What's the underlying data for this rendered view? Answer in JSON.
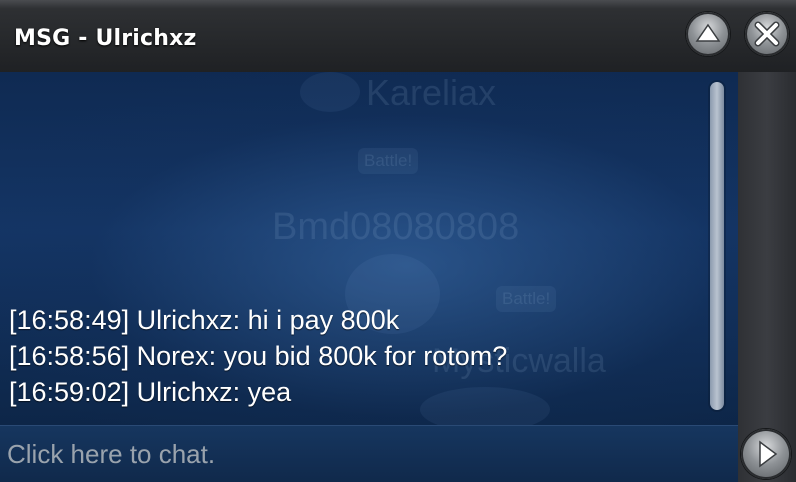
{
  "window": {
    "title": "MSG - Ulrichxz",
    "buttons": {
      "collapse_icon": "triangle-up-icon",
      "close_icon": "close-x-icon"
    }
  },
  "background": {
    "names": [
      "Kareliax",
      "Bmd08080808",
      "Mysticwalla"
    ],
    "badges": [
      "Battle!",
      "Battle!"
    ]
  },
  "chat": {
    "messages": [
      {
        "time": "[16:58:49]",
        "sender": "Ulrichxz",
        "text": "hi i pay 800k",
        "line": "[16:58:49] Ulrichxz: hi i pay 800k"
      },
      {
        "time": "[16:58:56]",
        "sender": "Norex",
        "text": "you bid 800k for rotom?",
        "line": "[16:58:56] Norex: you bid 800k for rotom?"
      },
      {
        "time": "[16:59:02]",
        "sender": "Ulrichxz",
        "text": "yea",
        "line": "[16:59:02] Ulrichxz: yea"
      }
    ]
  },
  "input": {
    "placeholder": "Click here to chat.",
    "value": ""
  },
  "send": {
    "icon": "play-arrow-icon"
  },
  "colors": {
    "chat_bg": "#143565",
    "title_bar": "#1f2124",
    "text": "#ffffff",
    "placeholder": "#9aa3ad"
  }
}
